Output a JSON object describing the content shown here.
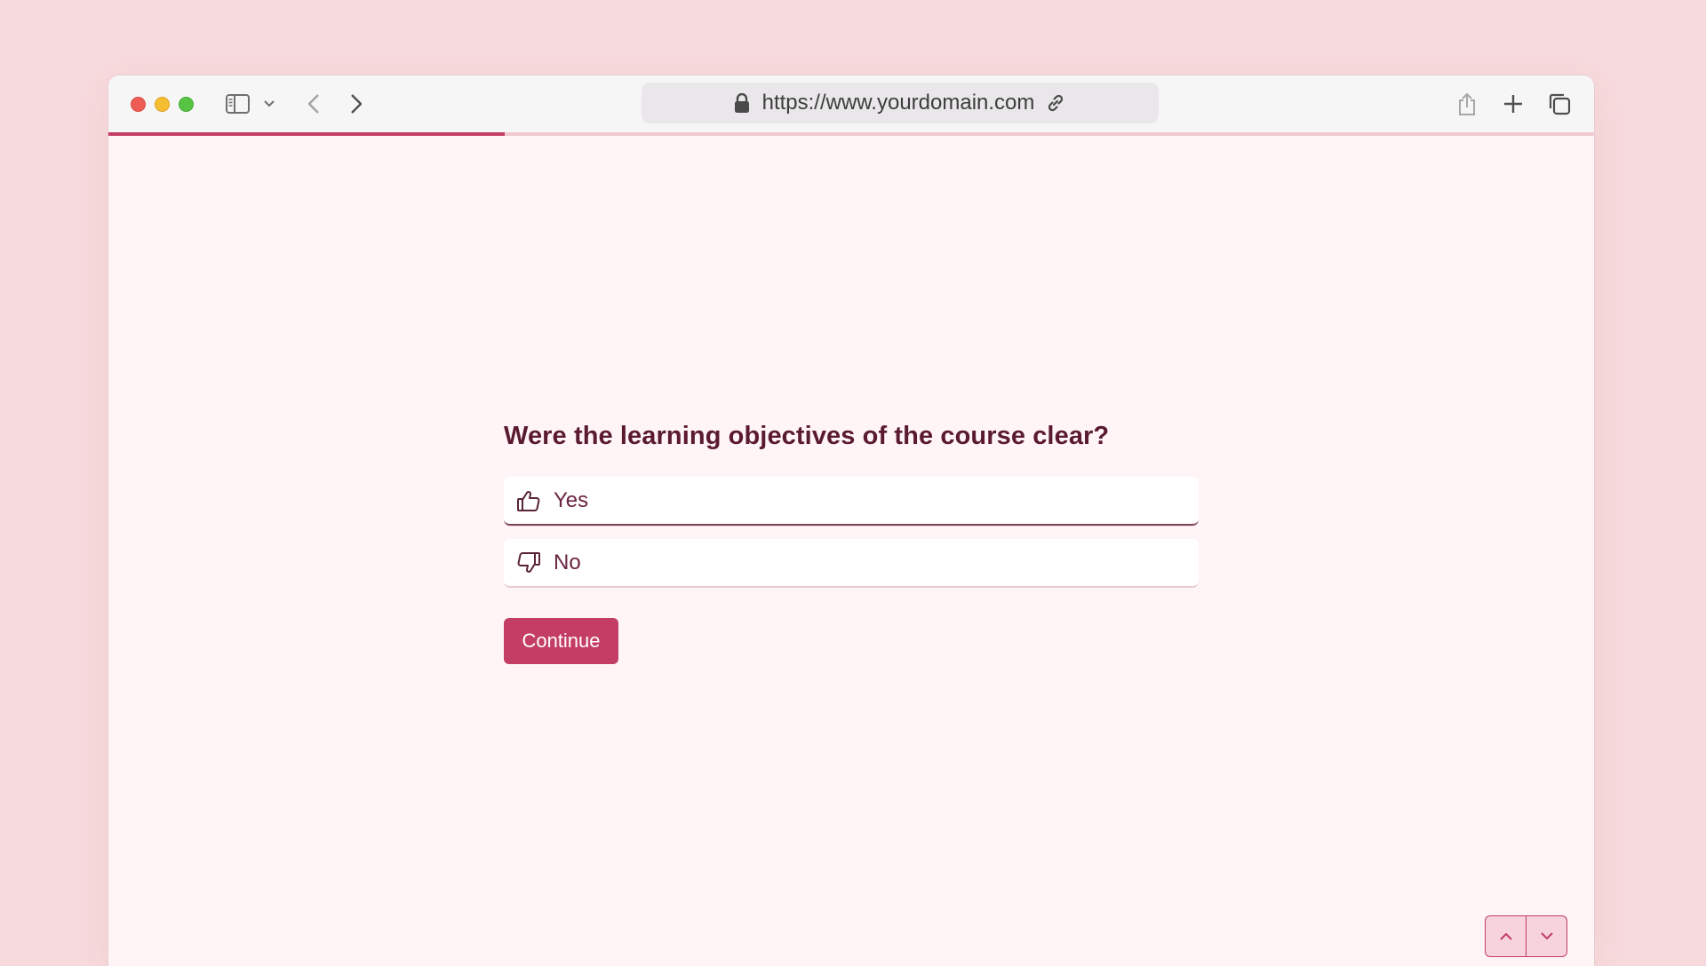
{
  "browser": {
    "url": "https://www.yourdomain.com",
    "icons": [
      "sidebar-icon",
      "chevron-down-icon",
      "back-icon",
      "forward-icon",
      "lock-icon",
      "link-icon",
      "share-icon",
      "plus-icon",
      "tabs-icon"
    ]
  },
  "progress": {
    "fraction": 0.267,
    "color": "#c33d64"
  },
  "survey": {
    "question": "Were the learning objectives of the course clear?",
    "options": [
      {
        "label": "Yes",
        "icon": "thumbs-up-icon"
      },
      {
        "label": "No",
        "icon": "thumbs-down-icon"
      }
    ],
    "continue_label": "Continue"
  },
  "pager": {
    "icons": [
      "chevron-up-icon",
      "chevron-down-icon"
    ]
  },
  "colors": {
    "accent": "#c33d64",
    "text": "#5a1a30",
    "page_background": "#fff5f7",
    "desk_background": "#f7dadd"
  }
}
